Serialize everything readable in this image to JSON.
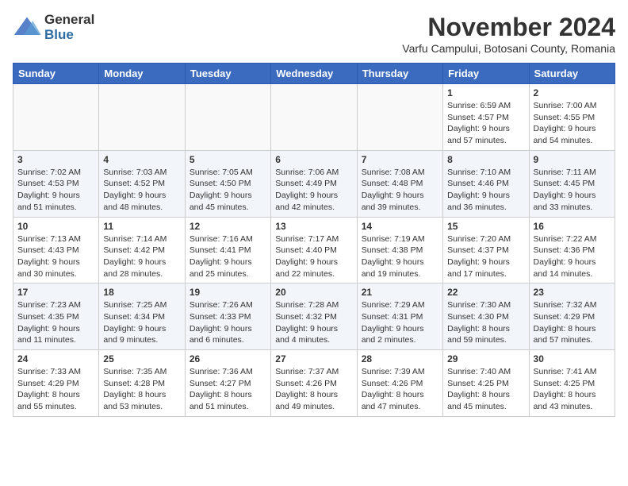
{
  "logo": {
    "general": "General",
    "blue": "Blue"
  },
  "header": {
    "month": "November 2024",
    "location": "Varfu Campului, Botosani County, Romania"
  },
  "days_of_week": [
    "Sunday",
    "Monday",
    "Tuesday",
    "Wednesday",
    "Thursday",
    "Friday",
    "Saturday"
  ],
  "weeks": [
    [
      {
        "day": "",
        "info": ""
      },
      {
        "day": "",
        "info": ""
      },
      {
        "day": "",
        "info": ""
      },
      {
        "day": "",
        "info": ""
      },
      {
        "day": "",
        "info": ""
      },
      {
        "day": "1",
        "info": "Sunrise: 6:59 AM\nSunset: 4:57 PM\nDaylight: 9 hours and 57 minutes."
      },
      {
        "day": "2",
        "info": "Sunrise: 7:00 AM\nSunset: 4:55 PM\nDaylight: 9 hours and 54 minutes."
      }
    ],
    [
      {
        "day": "3",
        "info": "Sunrise: 7:02 AM\nSunset: 4:53 PM\nDaylight: 9 hours and 51 minutes."
      },
      {
        "day": "4",
        "info": "Sunrise: 7:03 AM\nSunset: 4:52 PM\nDaylight: 9 hours and 48 minutes."
      },
      {
        "day": "5",
        "info": "Sunrise: 7:05 AM\nSunset: 4:50 PM\nDaylight: 9 hours and 45 minutes."
      },
      {
        "day": "6",
        "info": "Sunrise: 7:06 AM\nSunset: 4:49 PM\nDaylight: 9 hours and 42 minutes."
      },
      {
        "day": "7",
        "info": "Sunrise: 7:08 AM\nSunset: 4:48 PM\nDaylight: 9 hours and 39 minutes."
      },
      {
        "day": "8",
        "info": "Sunrise: 7:10 AM\nSunset: 4:46 PM\nDaylight: 9 hours and 36 minutes."
      },
      {
        "day": "9",
        "info": "Sunrise: 7:11 AM\nSunset: 4:45 PM\nDaylight: 9 hours and 33 minutes."
      }
    ],
    [
      {
        "day": "10",
        "info": "Sunrise: 7:13 AM\nSunset: 4:43 PM\nDaylight: 9 hours and 30 minutes."
      },
      {
        "day": "11",
        "info": "Sunrise: 7:14 AM\nSunset: 4:42 PM\nDaylight: 9 hours and 28 minutes."
      },
      {
        "day": "12",
        "info": "Sunrise: 7:16 AM\nSunset: 4:41 PM\nDaylight: 9 hours and 25 minutes."
      },
      {
        "day": "13",
        "info": "Sunrise: 7:17 AM\nSunset: 4:40 PM\nDaylight: 9 hours and 22 minutes."
      },
      {
        "day": "14",
        "info": "Sunrise: 7:19 AM\nSunset: 4:38 PM\nDaylight: 9 hours and 19 minutes."
      },
      {
        "day": "15",
        "info": "Sunrise: 7:20 AM\nSunset: 4:37 PM\nDaylight: 9 hours and 17 minutes."
      },
      {
        "day": "16",
        "info": "Sunrise: 7:22 AM\nSunset: 4:36 PM\nDaylight: 9 hours and 14 minutes."
      }
    ],
    [
      {
        "day": "17",
        "info": "Sunrise: 7:23 AM\nSunset: 4:35 PM\nDaylight: 9 hours and 11 minutes."
      },
      {
        "day": "18",
        "info": "Sunrise: 7:25 AM\nSunset: 4:34 PM\nDaylight: 9 hours and 9 minutes."
      },
      {
        "day": "19",
        "info": "Sunrise: 7:26 AM\nSunset: 4:33 PM\nDaylight: 9 hours and 6 minutes."
      },
      {
        "day": "20",
        "info": "Sunrise: 7:28 AM\nSunset: 4:32 PM\nDaylight: 9 hours and 4 minutes."
      },
      {
        "day": "21",
        "info": "Sunrise: 7:29 AM\nSunset: 4:31 PM\nDaylight: 9 hours and 2 minutes."
      },
      {
        "day": "22",
        "info": "Sunrise: 7:30 AM\nSunset: 4:30 PM\nDaylight: 8 hours and 59 minutes."
      },
      {
        "day": "23",
        "info": "Sunrise: 7:32 AM\nSunset: 4:29 PM\nDaylight: 8 hours and 57 minutes."
      }
    ],
    [
      {
        "day": "24",
        "info": "Sunrise: 7:33 AM\nSunset: 4:29 PM\nDaylight: 8 hours and 55 minutes."
      },
      {
        "day": "25",
        "info": "Sunrise: 7:35 AM\nSunset: 4:28 PM\nDaylight: 8 hours and 53 minutes."
      },
      {
        "day": "26",
        "info": "Sunrise: 7:36 AM\nSunset: 4:27 PM\nDaylight: 8 hours and 51 minutes."
      },
      {
        "day": "27",
        "info": "Sunrise: 7:37 AM\nSunset: 4:26 PM\nDaylight: 8 hours and 49 minutes."
      },
      {
        "day": "28",
        "info": "Sunrise: 7:39 AM\nSunset: 4:26 PM\nDaylight: 8 hours and 47 minutes."
      },
      {
        "day": "29",
        "info": "Sunrise: 7:40 AM\nSunset: 4:25 PM\nDaylight: 8 hours and 45 minutes."
      },
      {
        "day": "30",
        "info": "Sunrise: 7:41 AM\nSunset: 4:25 PM\nDaylight: 8 hours and 43 minutes."
      }
    ]
  ]
}
